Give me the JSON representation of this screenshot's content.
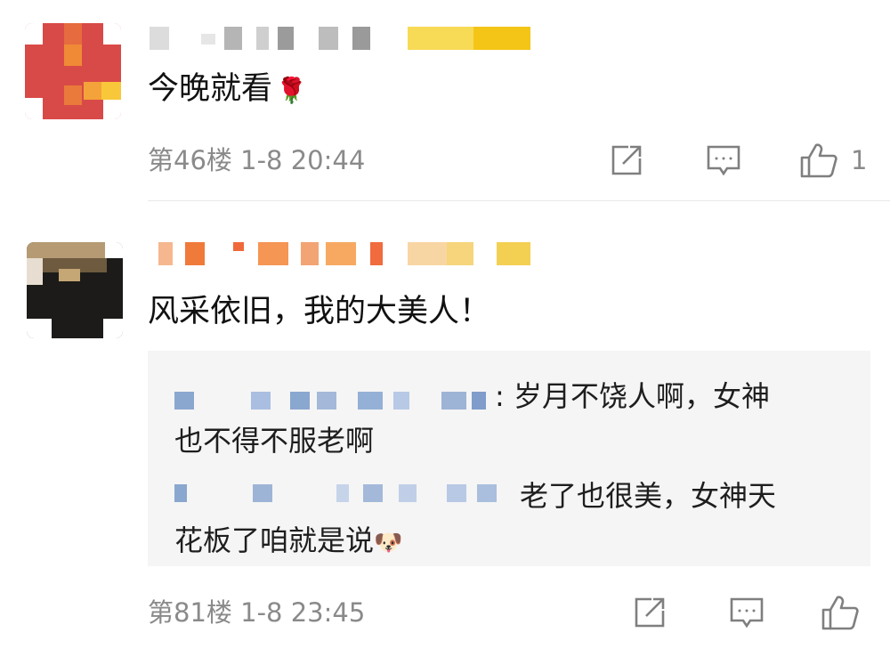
{
  "comments": [
    {
      "text": "今晚就看",
      "emoji": "🌹",
      "meta": "第46楼 1-8 20:44",
      "likes": "1",
      "icons": [
        "share-icon",
        "comment-icon",
        "like-icon"
      ]
    },
    {
      "text": "风采依旧，我的大美人！",
      "meta": "第81楼 1-8 23:45",
      "icons": [
        "share-icon",
        "comment-icon",
        "like-icon"
      ],
      "replies": [
        {
          "line1": ": 岁月不饶人啊，女神",
          "line2": "也不得不服老啊"
        },
        {
          "line1": "老了也很美，女神天",
          "line2": "花板了咱就是说",
          "emoji": "🐶"
        }
      ]
    }
  ],
  "colors": {
    "meta": "#8a8a8a",
    "reply_bg": "#f5f5f5",
    "divider": "#e9e9e9"
  }
}
